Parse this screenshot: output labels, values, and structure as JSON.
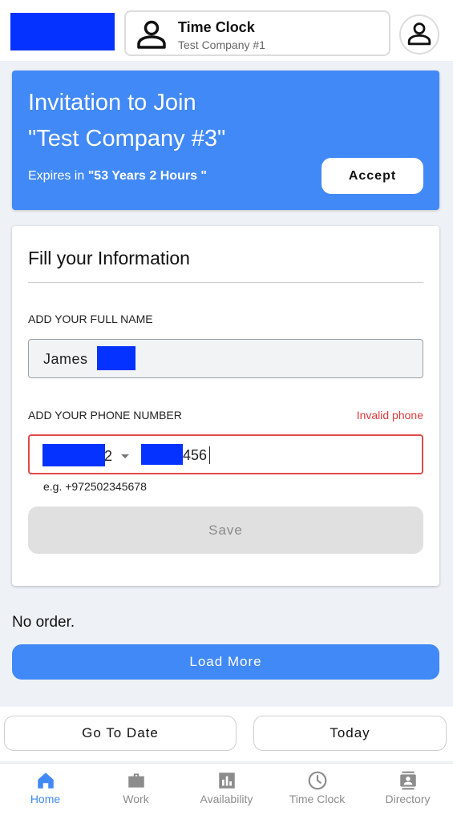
{
  "header": {
    "logo": "",
    "company_switcher": {
      "title": "Time Clock",
      "subtitle": "Test Company #1",
      "icon": "person-icon"
    },
    "account_icon": "person-icon"
  },
  "invitation": {
    "line1": "Invitation to Join",
    "line2": "\"Test Company #3\"",
    "expires_prefix": "Expires in ",
    "expires_value": "\"53 Years 2 Hours \"",
    "accept_label": "Accept",
    "accent_color": "#4189f6"
  },
  "form": {
    "heading": "Fill your Information",
    "name_label": "ADD YOUR FULL NAME",
    "name_value": "James",
    "phone_label": "ADD YOUR PHONE NUMBER",
    "phone_error": "Invalid phone",
    "phone_country_code": "2",
    "phone_number": "456",
    "phone_hint": "e.g. +972502345678",
    "save_label": "Save"
  },
  "list": {
    "empty_text": "No order.",
    "load_more_label": "Load More"
  },
  "date_bar": {
    "go_to_date_label": "Go To Date",
    "today_label": "Today"
  },
  "bottom_nav": {
    "items": [
      {
        "label": "Home",
        "icon": "home-icon",
        "active": true
      },
      {
        "label": "Work",
        "icon": "briefcase-icon",
        "active": false
      },
      {
        "label": "Availability",
        "icon": "bar-chart-icon",
        "active": false
      },
      {
        "label": "Time Clock",
        "icon": "clock-icon",
        "active": false
      },
      {
        "label": "Directory",
        "icon": "contacts-icon",
        "active": false
      }
    ]
  },
  "colors": {
    "primary": "#4189f6",
    "error": "#e03a3a",
    "redaction": "#0532ff"
  }
}
